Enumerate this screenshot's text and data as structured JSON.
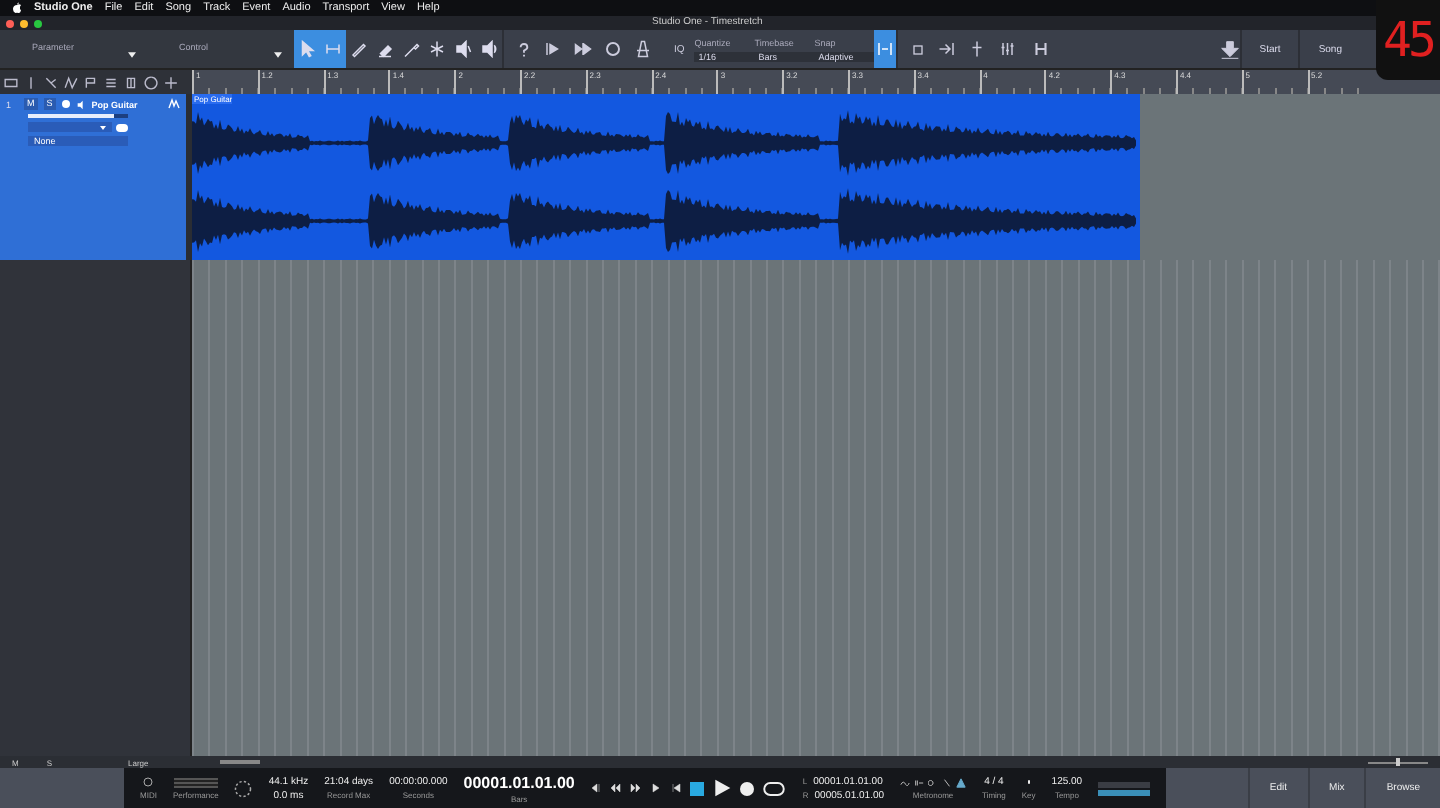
{
  "menu_bar": {
    "app": "Studio One",
    "items": [
      "File",
      "Edit",
      "Song",
      "Track",
      "Event",
      "Audio",
      "Transport",
      "View",
      "Help"
    ]
  },
  "window": {
    "title": "Studio One - Timestretch"
  },
  "toolbar": {
    "parameter": "Parameter",
    "control": "Control",
    "tools": [
      {
        "kind": "arrow",
        "selected": true
      },
      {
        "kind": "range",
        "selected": true
      },
      {
        "kind": "pencil",
        "selected": false
      },
      {
        "kind": "eraser",
        "selected": false
      },
      {
        "kind": "paint",
        "selected": false
      },
      {
        "kind": "split",
        "selected": false
      },
      {
        "kind": "mute",
        "selected": false
      },
      {
        "kind": "listen",
        "selected": false
      }
    ],
    "iq": "IQ",
    "quantize": {
      "label": "Quantize",
      "value": "1/16"
    },
    "timebase": {
      "label": "Timebase",
      "value": "Bars"
    },
    "snap": {
      "label": "Snap",
      "value": "Adaptive",
      "on": true
    },
    "start": "Start",
    "song": "Song"
  },
  "counter": "45",
  "ruler": {
    "marks": [
      "1",
      "1.2",
      "1.3",
      "1.4",
      "2",
      "2.2",
      "2.3",
      "2.4",
      "3",
      "3.2",
      "3.3",
      "3.4",
      "4",
      "4.2",
      "4.3",
      "4.4",
      "5",
      "5.2"
    ]
  },
  "track": {
    "number": "1",
    "mute": "M",
    "solo": "S",
    "name": "Pop Guitar",
    "level": 0.85,
    "input": "None",
    "selected": true
  },
  "clip": {
    "name": "Pop Guitar"
  },
  "footer": {
    "mute": "M",
    "solo": "S",
    "zoom": "Large",
    "zoom_slider": {
      "level": 0.5
    }
  },
  "transport": {
    "midi": "MIDI",
    "performance": "Performance",
    "sample_rate": "44.1 kHz",
    "latency": "0.0 ms",
    "record_time": "21:04 days",
    "record_label": "Record Max",
    "seconds": "00:00:00.000",
    "seconds_label": "Seconds",
    "bars": "00001.01.01.00",
    "bars_label": "Bars",
    "left": {
      "label": "L",
      "value": "00001.01.01.00"
    },
    "right": {
      "label": "R",
      "value": "00005.01.01.00"
    },
    "metronome": "Metronome",
    "signature": "4 / 4",
    "timing": "Timing",
    "key": "Key",
    "tempo": "125.00",
    "tempo_label": "Tempo"
  },
  "pages": [
    "Edit",
    "Mix",
    "Browse"
  ]
}
